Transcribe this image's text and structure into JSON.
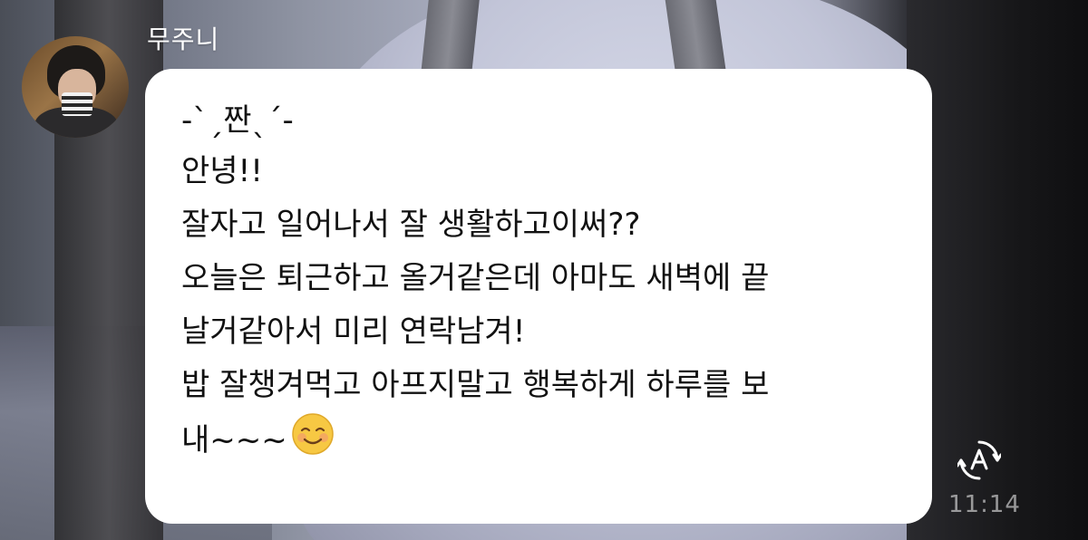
{
  "chat": {
    "sender_name": "무주니",
    "message_lines": [
      "-ˋˏ짠ˎˊ-",
      "안녕!!",
      "잘자고 일어나서 잘 생활하고이써??",
      "오늘은 퇴근하고 올거같은데 아마도 새벽에 끝",
      "날거같아서 미리 연락남겨!",
      "밥 잘챙겨먹고 아프지말고 행복하게 하루를 보",
      "내~~~"
    ],
    "emoji": "smiling-face-with-blush",
    "timestamp": "11:14",
    "status_icon": "auto-translate-icon"
  },
  "colors": {
    "bubble_bg": "#ffffff",
    "message_text": "#111111",
    "sender_text": "#ffffff",
    "timestamp_text": "rgba(255,255,255,0.55)",
    "emoji_face": "#f7c843"
  }
}
